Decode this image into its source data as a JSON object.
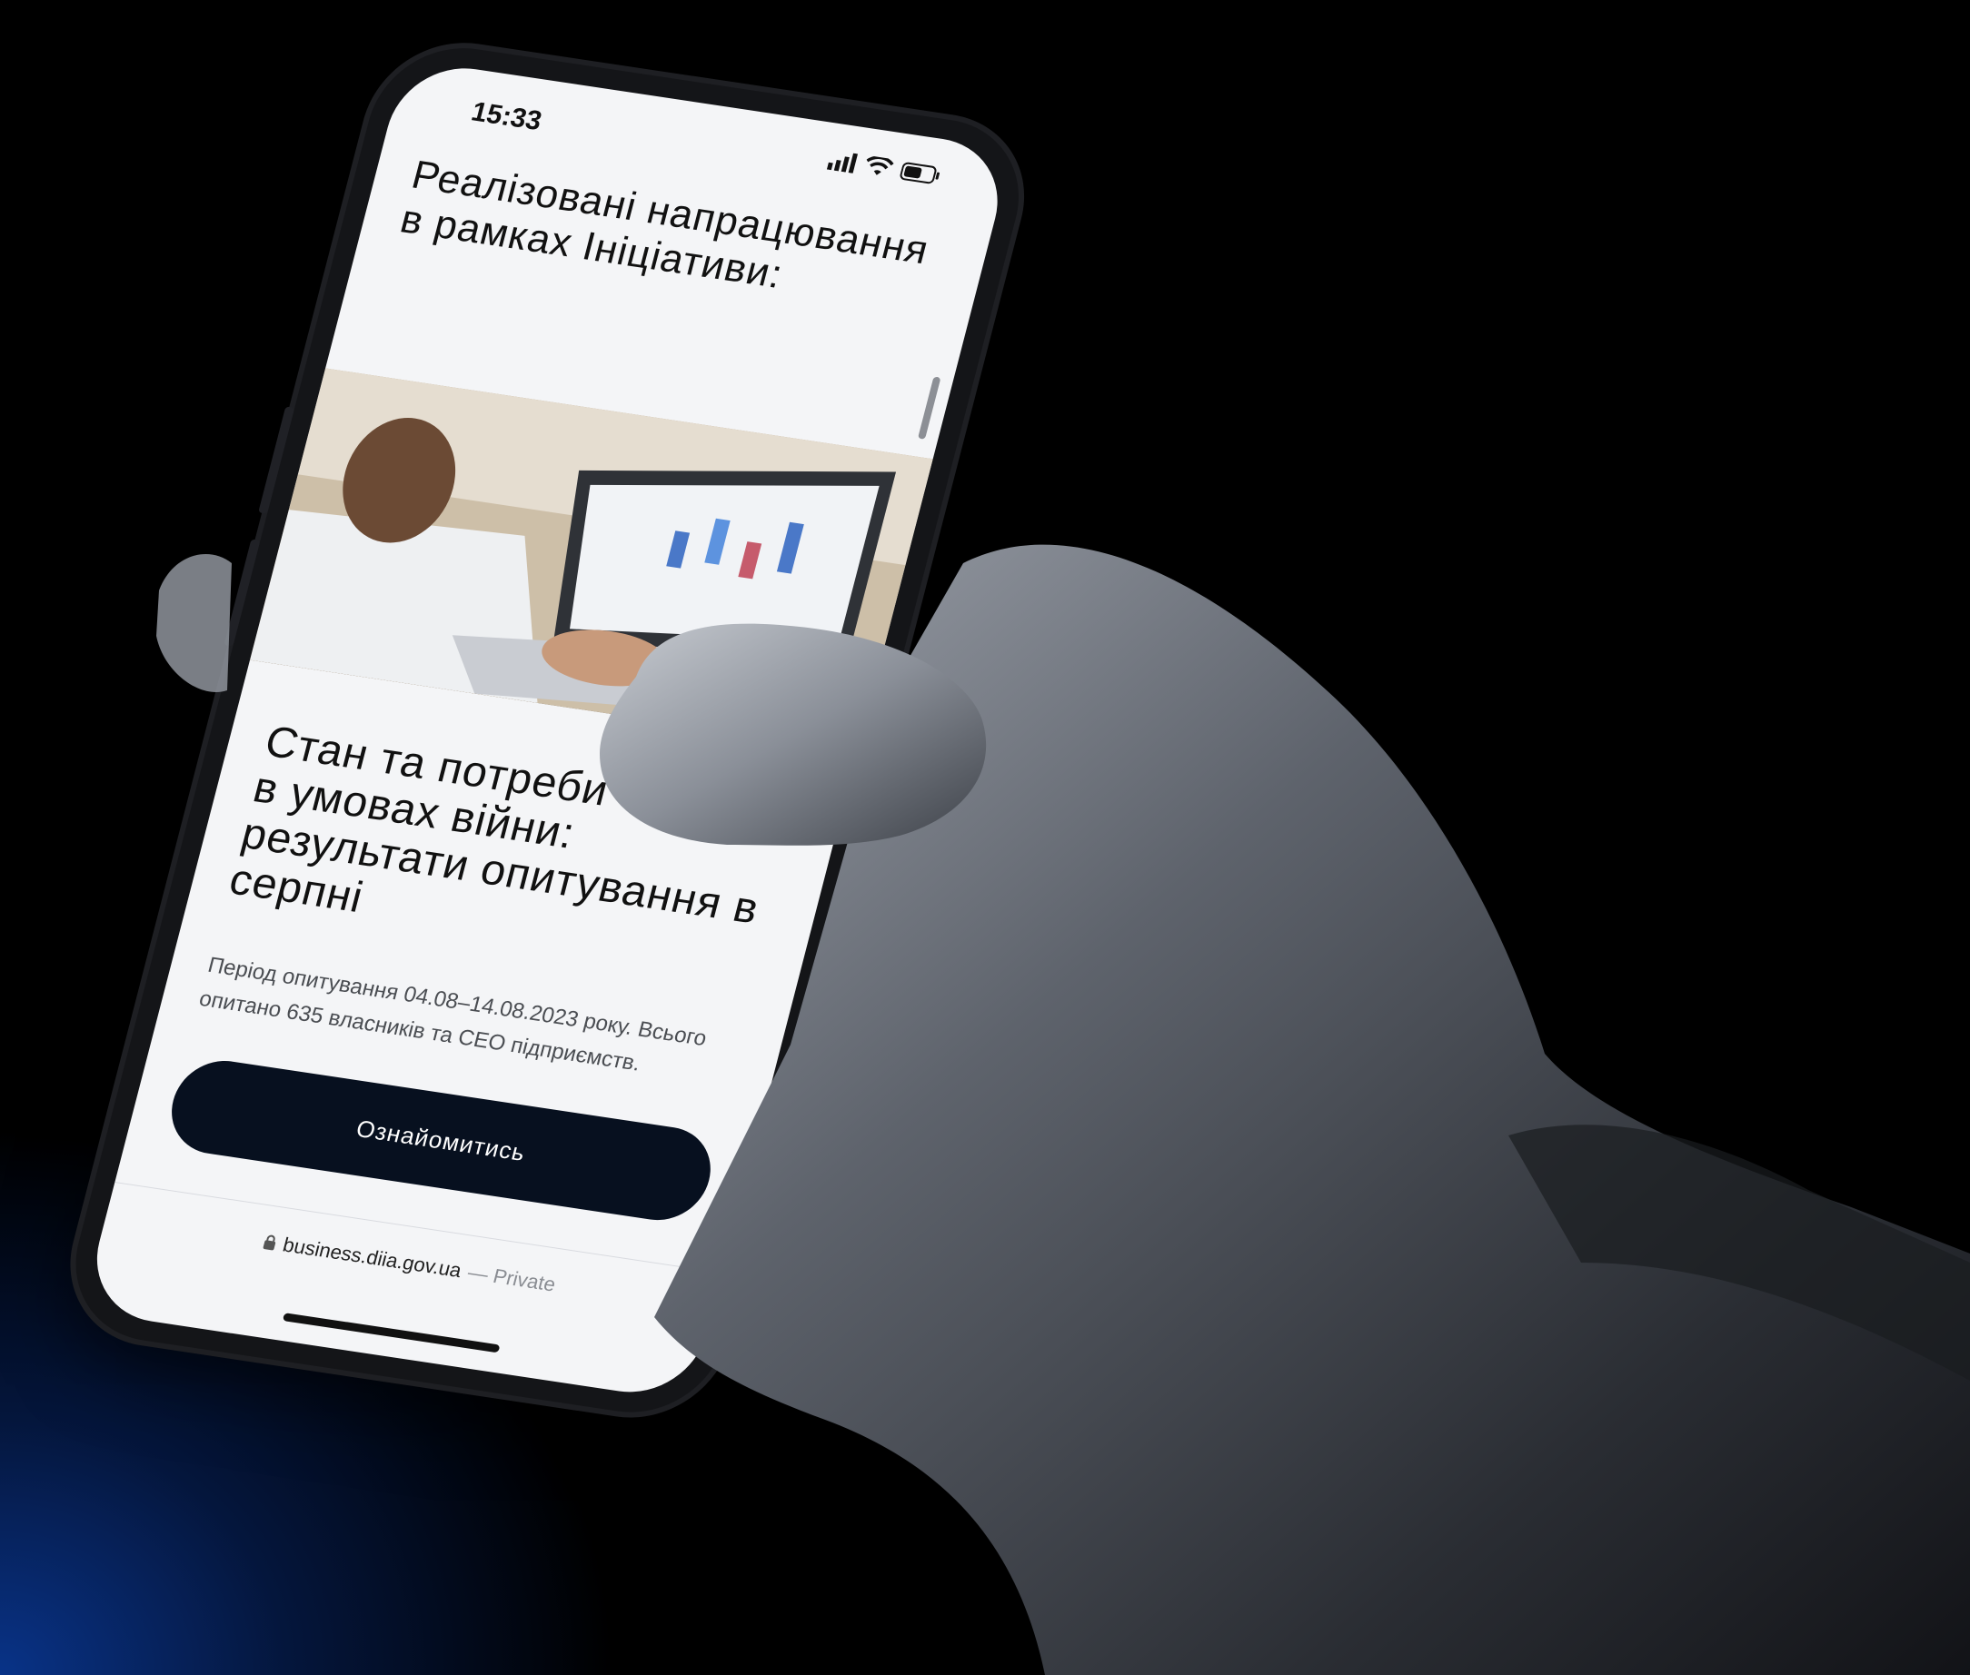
{
  "status_bar": {
    "time": "15:33"
  },
  "page": {
    "heading": "Реалізовані напрацювання в рамках Ініціативи:",
    "card": {
      "title": "Стан та потреби бізнесу в умовах війни: результати опитування в серпні",
      "description": "Період опитування 04.08–14.08.2023 року. Всього опитано 635 власників та CEO підприємств.",
      "button_label": "Ознайомитись"
    }
  },
  "browser": {
    "url": "business.diia.gov.ua",
    "mode": "— Private"
  },
  "colors": {
    "background": "#000000",
    "accent_glow": "#0a3ca0",
    "button": "#07101f",
    "screen": "#f4f5f7"
  }
}
